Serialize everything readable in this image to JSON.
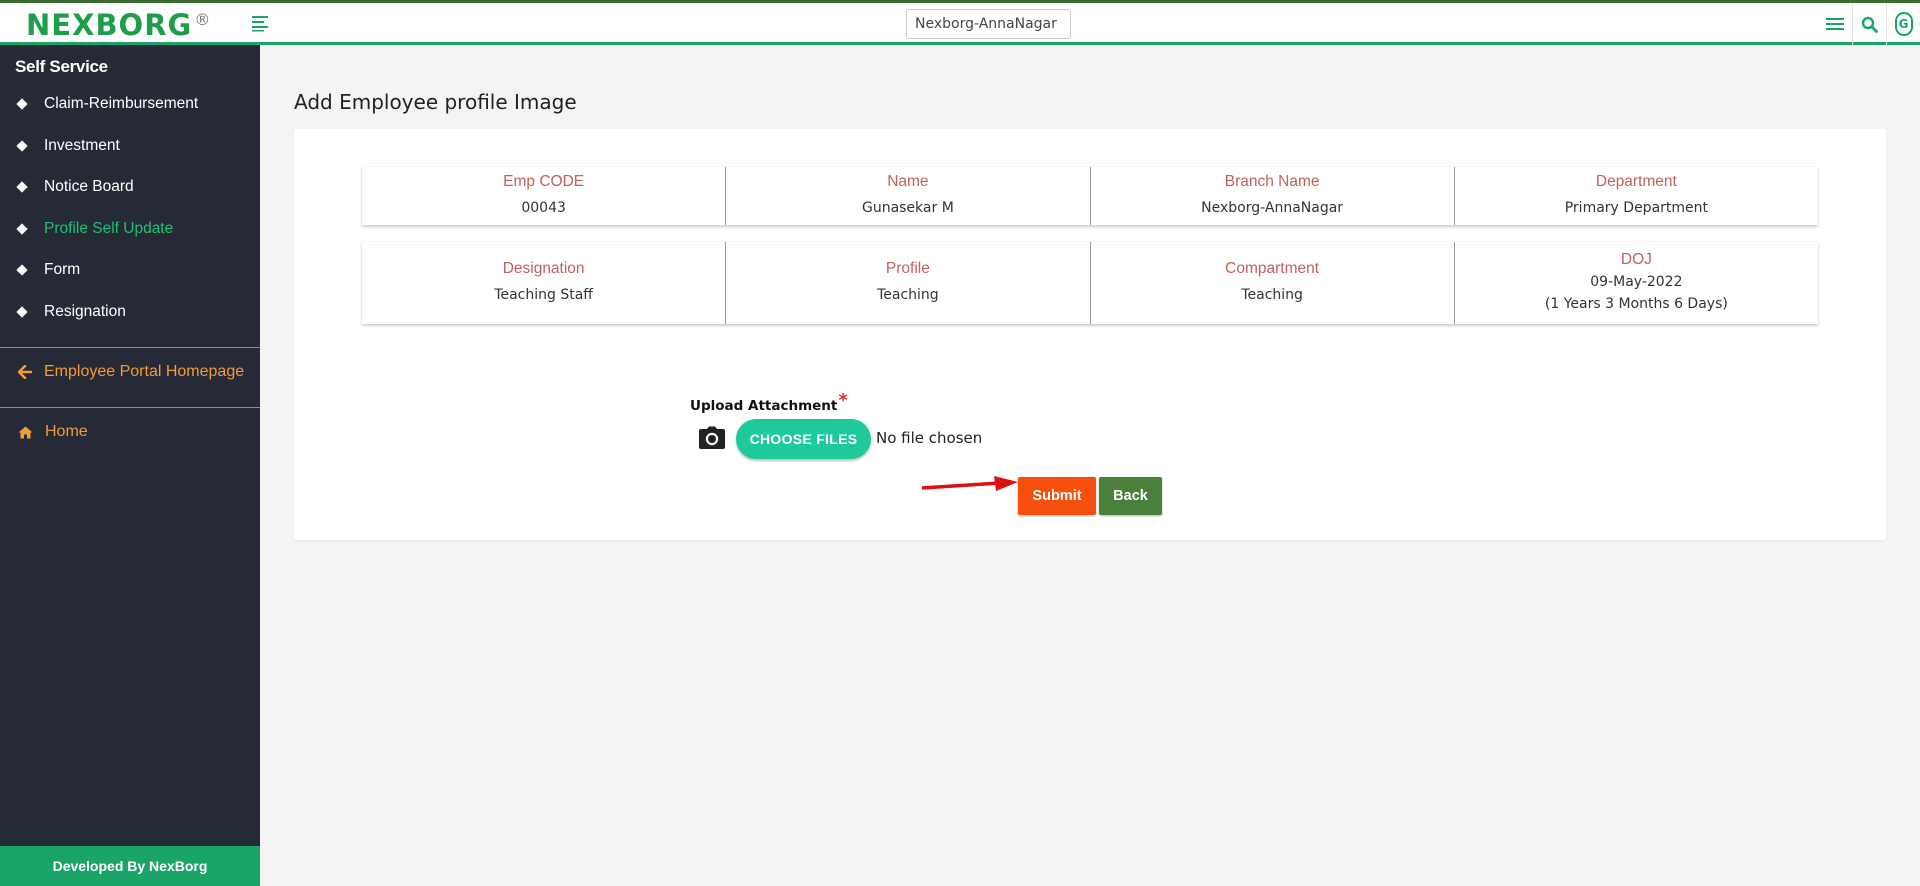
{
  "header": {
    "logo_text": "NEXBORG",
    "logo_reg": "®",
    "branch": "Nexborg-AnnaNagar",
    "user_initial": "G",
    "colors": {
      "brand_green": "#1aa46a",
      "top_border": "#3a6b2f"
    }
  },
  "sidebar": {
    "heading": "Self Service",
    "items": [
      {
        "label": "Claim-Reimbursement",
        "active": false
      },
      {
        "label": "Investment",
        "active": false
      },
      {
        "label": "Notice Board",
        "active": false
      },
      {
        "label": "Profile Self Update",
        "active": true
      },
      {
        "label": "Form",
        "active": false
      },
      {
        "label": "Resignation",
        "active": false
      }
    ],
    "portal_link": "Employee Portal Homepage",
    "home_link": "Home",
    "footer": "Developed By NexBorg"
  },
  "main": {
    "title": "Add Employee profile Image",
    "info_row1": [
      {
        "label": "Emp CODE",
        "value": "00043"
      },
      {
        "label": "Name",
        "value": "Gunasekar M"
      },
      {
        "label": "Branch Name",
        "value": "Nexborg-AnnaNagar"
      },
      {
        "label": "Department",
        "value": "Primary Department"
      }
    ],
    "info_row2": [
      {
        "label": "Designation",
        "value": "Teaching Staff"
      },
      {
        "label": "Profile",
        "value": "Teaching"
      },
      {
        "label": "Compartment",
        "value": "Teaching"
      },
      {
        "label": "DOJ",
        "value": "09-May-2022",
        "extra": "(1 Years 3 Months 6 Days)"
      }
    ],
    "upload": {
      "label": "Upload Attachment",
      "required_mark": "*",
      "button": "CHOOSE FILES",
      "status": "No file chosen"
    },
    "submit_label": "Submit",
    "back_label": "Back"
  }
}
